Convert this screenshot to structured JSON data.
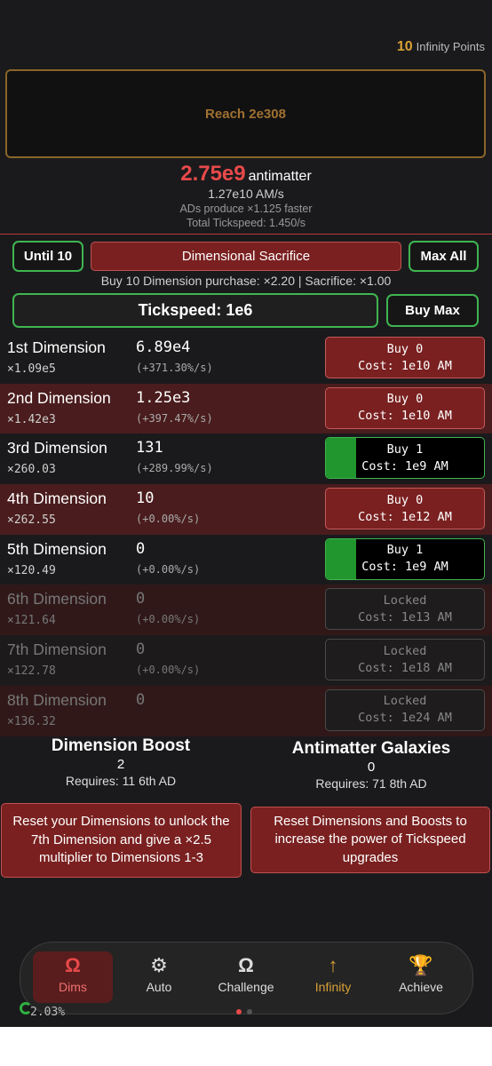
{
  "infinity_points": {
    "value": "10",
    "label": "Infinity Points"
  },
  "reach": {
    "label": "Reach 2e308"
  },
  "antimatter": {
    "value": "2.75e9",
    "unit": "antimatter",
    "rate": "1.27e10 AM/s",
    "ad_produce": "ADs produce ×1.125 faster",
    "total_tickspeed": "Total Tickspeed: 1.450/s"
  },
  "controls": {
    "until_label": "Until 10",
    "sacrifice_label": "Dimensional Sacrifice",
    "maxall_label": "Max All",
    "buy10_text": "Buy 10 Dimension purchase: ×2.20 | Sacrifice: ×1.00",
    "tickspeed_label": "Tickspeed: 1e6",
    "buymax_label": "Buy Max"
  },
  "dimensions": [
    {
      "name": "1st Dimension",
      "mult": "×1.09e5",
      "amount": "6.89e4",
      "rate": "(+371.30%/s)",
      "btn_top": "Buy 0",
      "btn_cost": "Cost: 1e10 AM",
      "state": "noafford"
    },
    {
      "name": "2nd Dimension",
      "mult": "×1.42e3",
      "amount": "1.25e3",
      "rate": "(+397.47%/s)",
      "btn_top": "Buy 0",
      "btn_cost": "Cost: 1e10 AM",
      "state": "noafford"
    },
    {
      "name": "3rd Dimension",
      "mult": "×260.03",
      "amount": "131",
      "rate": "(+289.99%/s)",
      "btn_top": "Buy 1",
      "btn_cost": "Cost: 1e9 AM",
      "state": "afford"
    },
    {
      "name": "4th Dimension",
      "mult": "×262.55",
      "amount": "10",
      "rate": "(+0.00%/s)",
      "btn_top": "Buy 0",
      "btn_cost": "Cost: 1e12 AM",
      "state": "noafford"
    },
    {
      "name": "5th Dimension",
      "mult": "×120.49",
      "amount": "0",
      "rate": "(+0.00%/s)",
      "btn_top": "Buy 1",
      "btn_cost": "Cost: 1e9 AM",
      "state": "afford"
    },
    {
      "name": "6th Dimension",
      "mult": "×121.64",
      "amount": "0",
      "rate": "(+0.00%/s)",
      "btn_top": "Locked",
      "btn_cost": "Cost: 1e13 AM",
      "state": "locked"
    },
    {
      "name": "7th Dimension",
      "mult": "×122.78",
      "amount": "0",
      "rate": "(+0.00%/s)",
      "btn_top": "Locked",
      "btn_cost": "Cost: 1e18 AM",
      "state": "locked"
    },
    {
      "name": "8th Dimension",
      "mult": "×136.32",
      "amount": "0",
      "rate": "",
      "btn_top": "Locked",
      "btn_cost": "Cost: 1e24 AM",
      "state": "locked"
    }
  ],
  "boost": {
    "title": "Dimension Boost",
    "count": "2",
    "requires": "Requires: 11 6th AD",
    "button": "Reset your Dimensions to unlock the 7th Dimension and give a ×2.5 multiplier to Dimensions 1-3"
  },
  "galaxies": {
    "title": "Antimatter Galaxies",
    "count": "0",
    "requires": "Requires: 71 8th AD",
    "button": "Reset Dimensions and Boosts to increase the power of Tickspeed upgrades"
  },
  "nav": [
    {
      "label": "Dims",
      "icon": "omega-icon",
      "glyph": "Ω"
    },
    {
      "label": "Auto",
      "icon": "gear-icon",
      "glyph": "⚙"
    },
    {
      "label": "Challenge",
      "icon": "omega-icon",
      "glyph": "Ω"
    },
    {
      "label": "Infinity",
      "icon": "arrow-up-icon",
      "glyph": "↑"
    },
    {
      "label": "Achieve",
      "icon": "trophy-icon",
      "glyph": "🏆"
    }
  ],
  "progress_text": "2.03%",
  "colors": {
    "accent_red": "#e8494a",
    "infinity_gold": "#d9a036",
    "afford_green": "#3fb550"
  }
}
